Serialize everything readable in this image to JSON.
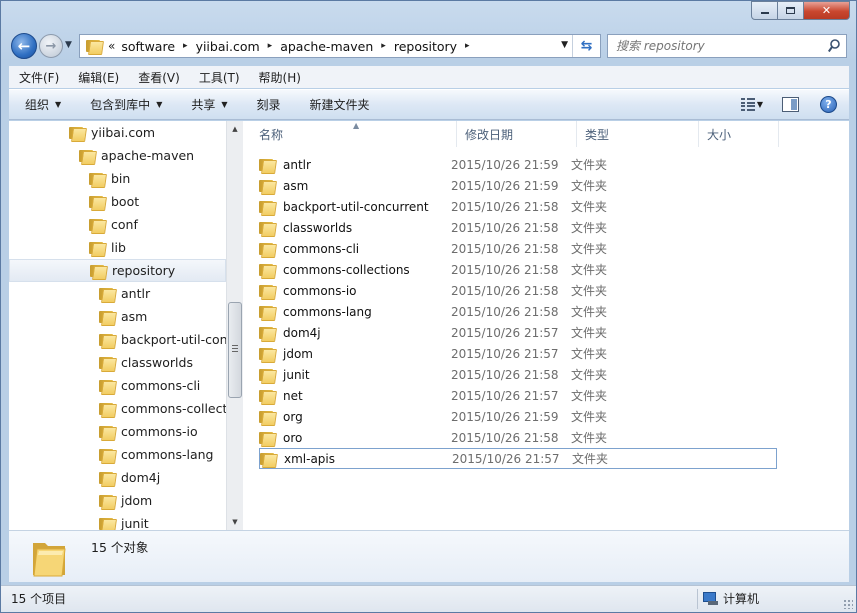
{
  "address": {
    "chevron": "«",
    "crumbs": [
      "software",
      "yiibai.com",
      "apache-maven",
      "repository"
    ]
  },
  "search": {
    "placeholder": "搜索 repository"
  },
  "menu": [
    "文件(F)",
    "编辑(E)",
    "查看(V)",
    "工具(T)",
    "帮助(H)"
  ],
  "commands": [
    {
      "label": "组织",
      "dropdown": true
    },
    {
      "label": "包含到库中",
      "dropdown": true
    },
    {
      "label": "共享",
      "dropdown": true
    },
    {
      "label": "刻录",
      "dropdown": false
    },
    {
      "label": "新建文件夹",
      "dropdown": false
    }
  ],
  "tree": {
    "items": [
      {
        "label": "yiibai.com",
        "depth": 0
      },
      {
        "label": "apache-maven",
        "depth": 1
      },
      {
        "label": "bin",
        "depth": 2
      },
      {
        "label": "boot",
        "depth": 2
      },
      {
        "label": "conf",
        "depth": 2
      },
      {
        "label": "lib",
        "depth": 2
      },
      {
        "label": "repository",
        "depth": 2,
        "selected": true
      },
      {
        "label": "antlr",
        "depth": 3
      },
      {
        "label": "asm",
        "depth": 3
      },
      {
        "label": "backport-util-conc",
        "depth": 3
      },
      {
        "label": "classworlds",
        "depth": 3
      },
      {
        "label": "commons-cli",
        "depth": 3
      },
      {
        "label": "commons-collecti",
        "depth": 3
      },
      {
        "label": "commons-io",
        "depth": 3
      },
      {
        "label": "commons-lang",
        "depth": 3
      },
      {
        "label": "dom4j",
        "depth": 3
      },
      {
        "label": "jdom",
        "depth": 3
      },
      {
        "label": "junit",
        "depth": 3
      }
    ]
  },
  "columns": {
    "name": "名称",
    "modified": "修改日期",
    "type": "类型",
    "size": "大小"
  },
  "files": [
    {
      "name": "antlr",
      "modified": "2015/10/26 21:59",
      "type": "文件夹"
    },
    {
      "name": "asm",
      "modified": "2015/10/26 21:59",
      "type": "文件夹"
    },
    {
      "name": "backport-util-concurrent",
      "modified": "2015/10/26 21:58",
      "type": "文件夹"
    },
    {
      "name": "classworlds",
      "modified": "2015/10/26 21:58",
      "type": "文件夹"
    },
    {
      "name": "commons-cli",
      "modified": "2015/10/26 21:58",
      "type": "文件夹"
    },
    {
      "name": "commons-collections",
      "modified": "2015/10/26 21:58",
      "type": "文件夹"
    },
    {
      "name": "commons-io",
      "modified": "2015/10/26 21:58",
      "type": "文件夹"
    },
    {
      "name": "commons-lang",
      "modified": "2015/10/26 21:58",
      "type": "文件夹"
    },
    {
      "name": "dom4j",
      "modified": "2015/10/26 21:57",
      "type": "文件夹"
    },
    {
      "name": "jdom",
      "modified": "2015/10/26 21:57",
      "type": "文件夹"
    },
    {
      "name": "junit",
      "modified": "2015/10/26 21:58",
      "type": "文件夹"
    },
    {
      "name": "net",
      "modified": "2015/10/26 21:57",
      "type": "文件夹"
    },
    {
      "name": "org",
      "modified": "2015/10/26 21:59",
      "type": "文件夹"
    },
    {
      "name": "oro",
      "modified": "2015/10/26 21:58",
      "type": "文件夹"
    },
    {
      "name": "xml-apis",
      "modified": "2015/10/26 21:57",
      "type": "文件夹",
      "focused": true
    }
  ],
  "details": {
    "count": "15 个对象"
  },
  "status": {
    "items": "15 个项目",
    "location": "计算机"
  },
  "icons": {
    "back": "arrow-left-icon",
    "forward": "arrow-right-icon",
    "refresh": "refresh-icon",
    "search": "magnifier-icon",
    "folder": "folder-icon",
    "help": "help-icon",
    "views": "view-options-icon",
    "preview": "preview-pane-icon",
    "computer": "computer-icon"
  },
  "colors": {
    "accent": "#2f6fc2",
    "frame": "#b9cfe6",
    "selection_border": "#7da2ce"
  }
}
